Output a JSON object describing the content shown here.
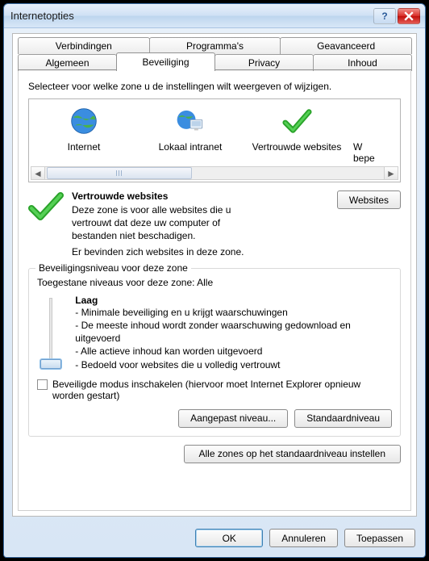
{
  "window": {
    "title": "Internetopties"
  },
  "tabs": {
    "row1": [
      "Verbindingen",
      "Programma's",
      "Geavanceerd"
    ],
    "row2": [
      "Algemeen",
      "Beveiliging",
      "Privacy",
      "Inhoud"
    ],
    "active": "Beveiliging"
  },
  "security": {
    "instruction": "Selecteer voor welke zone u de instellingen wilt weergeven of wijzigen.",
    "zones": [
      {
        "label": "Internet",
        "icon": "globe"
      },
      {
        "label": "Lokaal intranet",
        "icon": "globe-monitor"
      },
      {
        "label": "Vertrouwde websites",
        "icon": "check"
      },
      {
        "label": "Websites met beperkte toegang",
        "icon": "restricted",
        "truncated": "W\nbepe"
      }
    ],
    "selected_zone_title": "Vertrouwde websites",
    "selected_zone_desc": "Deze zone is voor alle websites die u vertrouwt dat deze uw computer of bestanden niet beschadigen.",
    "selected_zone_note": "Er bevinden zich websites in deze zone.",
    "sites_button": "Websites",
    "group_title": "Beveiligingsniveau voor deze zone",
    "allowed_levels": "Toegestane niveaus voor deze zone: Alle",
    "level": {
      "name": "Laag",
      "bullets": [
        "- Minimale beveiliging en u krijgt waarschuwingen",
        "- De meeste inhoud wordt zonder waarschuwing gedownload en uitgevoerd",
        "- Alle actieve inhoud kan worden uitgevoerd",
        "- Bedoeld voor websites die u volledig vertrouwt"
      ]
    },
    "protected_mode": "Beveiligde modus inschakelen (hiervoor moet Internet Explorer opnieuw worden gestart)",
    "custom_level_button": "Aangepast niveau...",
    "default_level_button": "Standaardniveau",
    "reset_all_button": "Alle zones op het standaardniveau instellen"
  },
  "commands": {
    "ok": "OK",
    "cancel": "Annuleren",
    "apply": "Toepassen"
  }
}
